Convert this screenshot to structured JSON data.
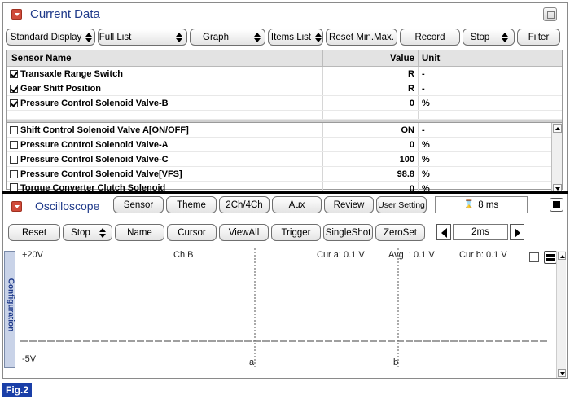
{
  "current_data": {
    "title": "Current Data",
    "toolbar": [
      {
        "label": "Standard Display",
        "spinner": true
      },
      {
        "label": "Full List",
        "spinner": true
      },
      {
        "label": "Graph",
        "spinner": true
      },
      {
        "label": "Items List",
        "spinner": true
      },
      {
        "label": "Reset Min.Max.",
        "spinner": false
      },
      {
        "label": "Record",
        "spinner": false
      },
      {
        "label": "Stop",
        "spinner": true
      },
      {
        "label": "Filter",
        "spinner": false
      }
    ],
    "columns": {
      "name": "Sensor Name",
      "value": "Value",
      "unit": "Unit"
    },
    "selected_rows": [
      {
        "name": "Transaxle Range Switch",
        "value": "R",
        "unit": "-",
        "checked": true
      },
      {
        "name": "Gear Shitf Position",
        "value": "R",
        "unit": "-",
        "checked": true
      },
      {
        "name": "Pressure Control Solenoid Valve-B",
        "value": "0",
        "unit": "%",
        "checked": true
      }
    ],
    "list_rows": [
      {
        "name": "Shift Control Solenoid Valve A[ON/OFF]",
        "value": "ON",
        "unit": "-",
        "checked": false
      },
      {
        "name": "Pressure Control Solenoid Valve-A",
        "value": "0",
        "unit": "%",
        "checked": false
      },
      {
        "name": "Pressure Control Solenoid Valve-C",
        "value": "100",
        "unit": "%",
        "checked": false
      },
      {
        "name": "Pressure Control Solenoid Valve[VFS]",
        "value": "98.8",
        "unit": "%",
        "checked": false
      },
      {
        "name": "Torque Converter Clutch Solenoid",
        "value": "0",
        "unit": "%",
        "checked": false
      }
    ]
  },
  "oscilloscope": {
    "title": "Oscilloscope",
    "header_buttons": [
      "Sensor",
      "Theme",
      "2Ch/4Ch",
      "Aux",
      "Review",
      "User Setting"
    ],
    "time_readout": "8 ms",
    "time_icon": "timer-icon",
    "toolbar": [
      {
        "label": "Reset",
        "spinner": false
      },
      {
        "label": "Stop",
        "spinner": true
      },
      {
        "label": "Name",
        "spinner": false
      },
      {
        "label": "Cursor",
        "spinner": false
      },
      {
        "label": "ViewAll",
        "spinner": false
      },
      {
        "label": "Trigger",
        "spinner": false
      },
      {
        "label": "SingleShot",
        "spinner": false
      },
      {
        "label": "ZeroSet",
        "spinner": false
      }
    ],
    "timebase": "2ms",
    "config_tab": "Configuration",
    "plot": {
      "y_max_label": "+20V",
      "y_min_label": "-5V",
      "channel": "Ch B",
      "cur_a": "Cur a: 0.1 V",
      "avg": "Avg  : 0.1 V",
      "cur_b": "Cur b: 0.1 V",
      "cursor_a": "a",
      "cursor_b": "b"
    }
  },
  "figure_label": "Fig.2",
  "colors": {
    "title_blue": "#1f3a8a",
    "fig_badge": "#1a3fa8",
    "collapse_red": "#d04a3a"
  }
}
